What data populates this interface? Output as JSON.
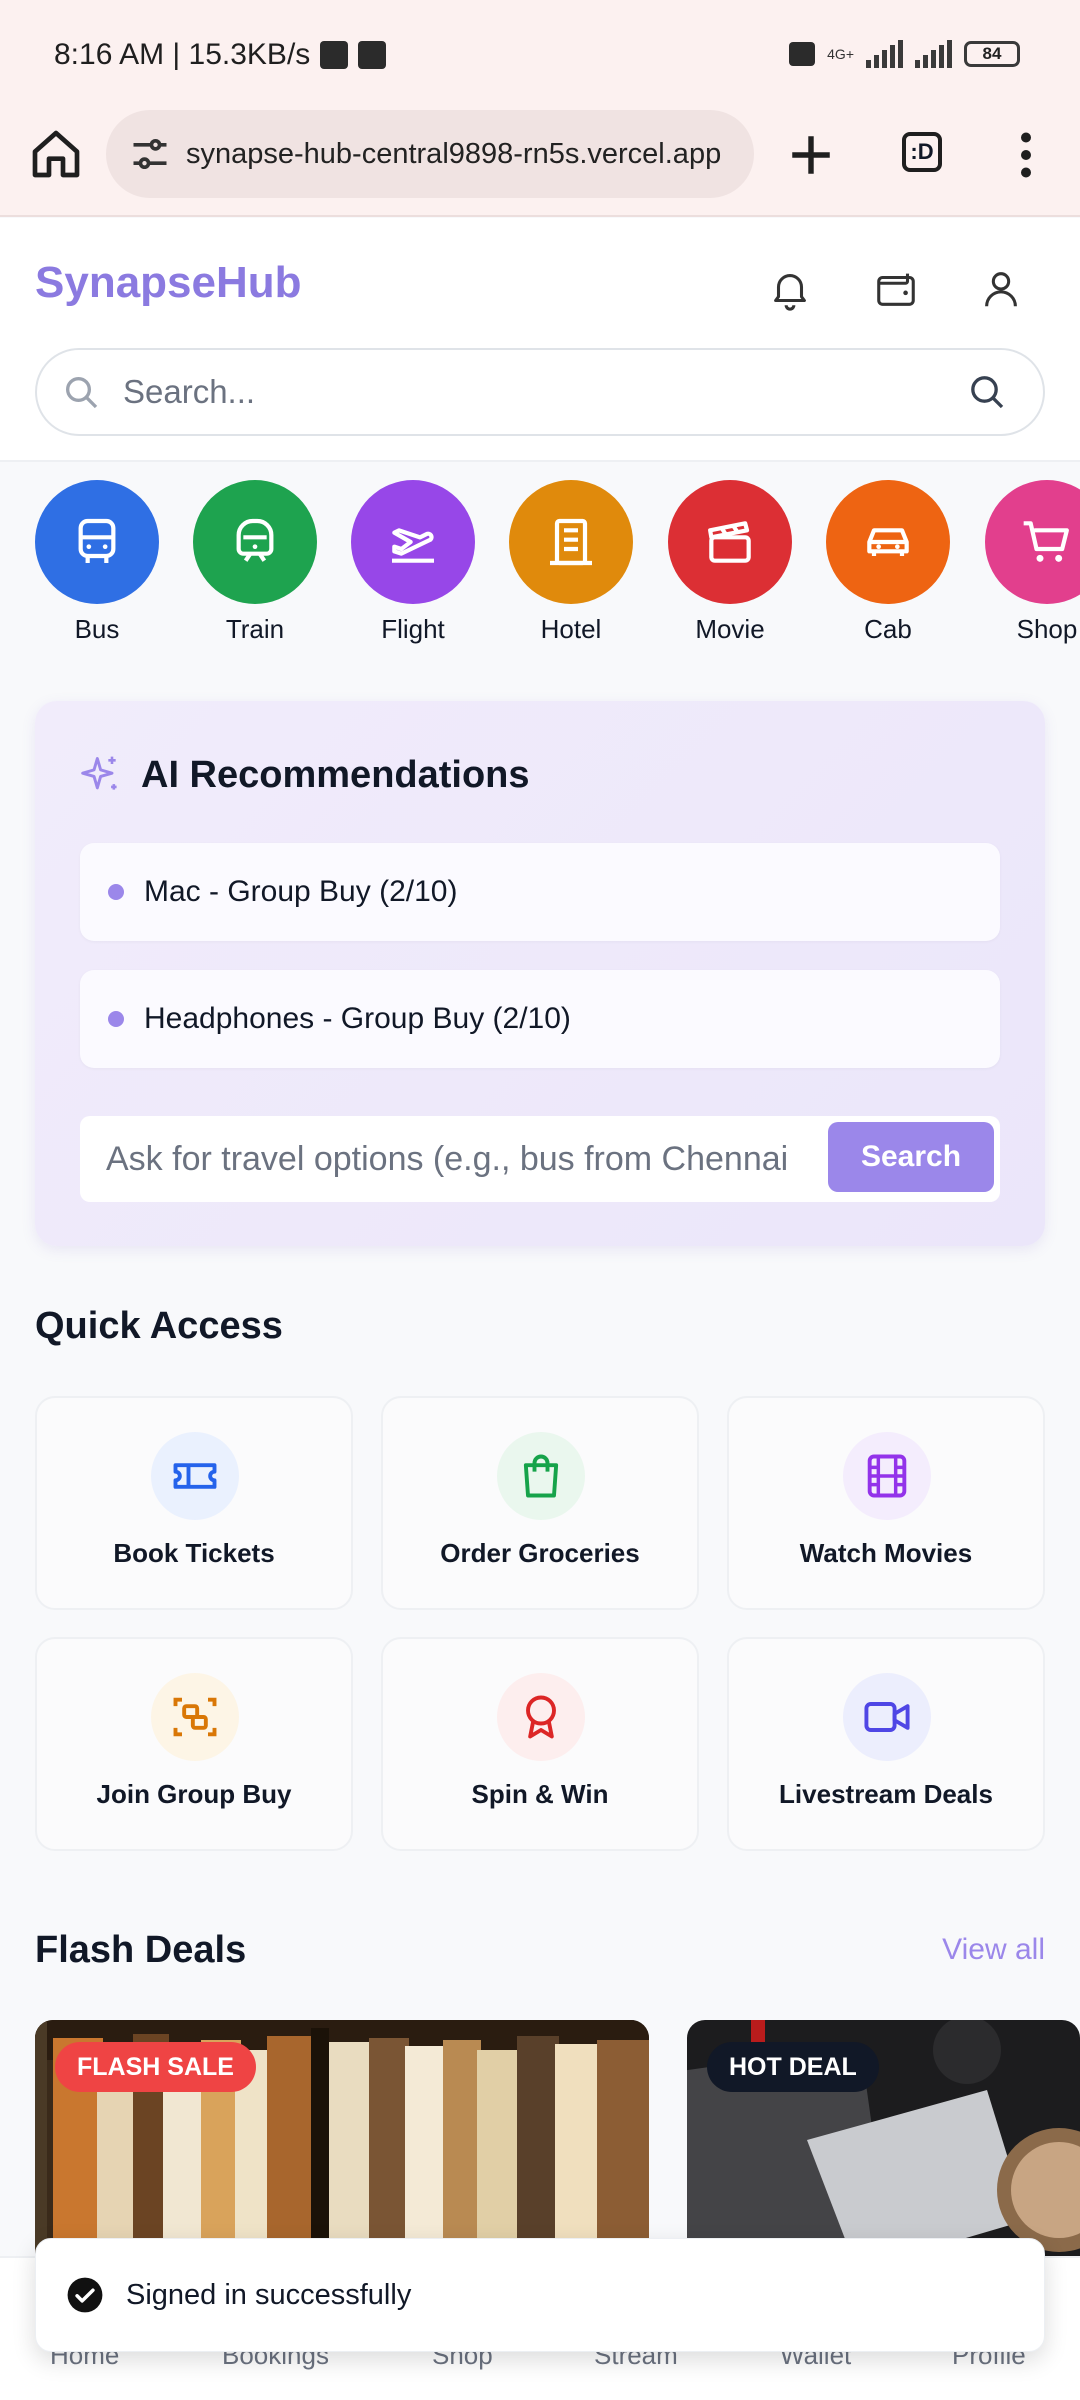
{
  "status_bar": {
    "time_speed": "8:16 AM | 15.3KB/s",
    "network": "4G+",
    "battery": "84"
  },
  "browser": {
    "url": "synapse-hub-central9898-rn5s.vercel.app",
    "tabs_label": ":D"
  },
  "header": {
    "brand": "SynapseHub",
    "search_placeholder": "Search..."
  },
  "categories": [
    {
      "label": "Bus",
      "icon": "bus-icon",
      "color": "#2f6fe4"
    },
    {
      "label": "Train",
      "icon": "train-icon",
      "color": "#1ea34f"
    },
    {
      "label": "Flight",
      "icon": "plane-icon",
      "color": "#9747e8"
    },
    {
      "label": "Hotel",
      "icon": "building-icon",
      "color": "#e08a0c"
    },
    {
      "label": "Movie",
      "icon": "clapperboard-icon",
      "color": "#dc2f34"
    },
    {
      "label": "Cab",
      "icon": "car-icon",
      "color": "#ee6412"
    },
    {
      "label": "Shop",
      "icon": "cart-icon",
      "color": "#e23f8d"
    }
  ],
  "ai": {
    "title": "AI Recommendations",
    "items": [
      "Mac - Group Buy (2/10)",
      "Headphones - Group Buy (2/10)"
    ],
    "ask_placeholder": "Ask for travel options (e.g., bus from Chennai",
    "search_label": "Search"
  },
  "quick_access": {
    "title": "Quick Access",
    "items": [
      {
        "label": "Book Tickets",
        "icon": "ticket-icon",
        "color": "#2563eb",
        "bg": "#eaf1fe"
      },
      {
        "label": "Order Groceries",
        "icon": "shopping-bag-icon",
        "color": "#16a34a",
        "bg": "#eaf7ee"
      },
      {
        "label": "Watch Movies",
        "icon": "film-icon",
        "color": "#9333ea",
        "bg": "#f4edfd"
      },
      {
        "label": "Join Group Buy",
        "icon": "group-icon",
        "color": "#d97706",
        "bg": "#fdf5e6"
      },
      {
        "label": "Spin & Win",
        "icon": "award-icon",
        "color": "#dc2626",
        "bg": "#fdeeee"
      },
      {
        "label": "Livestream Deals",
        "icon": "video-icon",
        "color": "#4f46e5",
        "bg": "#eceefd"
      }
    ]
  },
  "flash": {
    "title": "Flash Deals",
    "view_all": "View all",
    "deals": [
      {
        "badge": "FLASH SALE",
        "badge_color": "#ef4444"
      },
      {
        "badge": "HOT DEAL",
        "badge_color": "#111827"
      }
    ]
  },
  "bottom_nav": [
    "Home",
    "Bookings",
    "Shop",
    "Stream",
    "Wallet",
    "Profile"
  ],
  "toast": {
    "message": "Signed in successfully"
  }
}
